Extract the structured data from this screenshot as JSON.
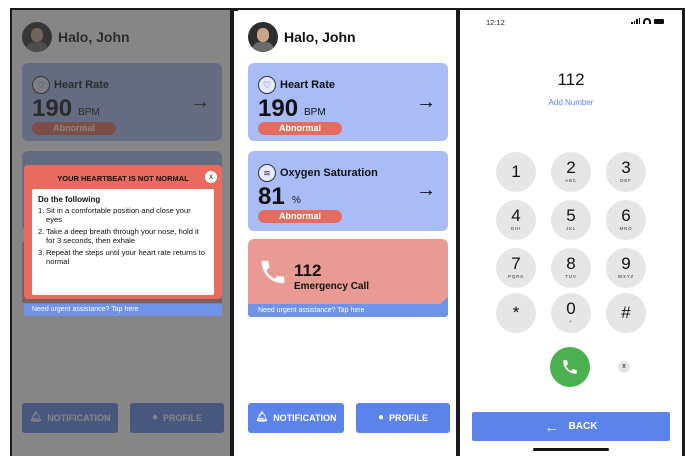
{
  "greeting": {
    "text": "Halo, John"
  },
  "heart_rate": {
    "title": "Heart Rate",
    "value": "190",
    "unit": "BPM",
    "status": "Abnormal"
  },
  "oxygen": {
    "title": "Oxygen Saturation",
    "value": "81",
    "unit": "%",
    "status": "Abnormal"
  },
  "emergency": {
    "number": "112",
    "label": "Emergency Call",
    "strip": "Need urgent assistance? Tap here"
  },
  "nav": {
    "notification": "NOTIFICATION",
    "profile": "PROFILE"
  },
  "modal": {
    "title": "YOUR HEARTBEAT IS NOT NORMAL",
    "close": "x",
    "lead": "Do the following",
    "steps": [
      {
        "n": "1.",
        "text": "Sit in a comfortable position and close your eyes"
      },
      {
        "n": "2.",
        "text": "Take a deep breath through your nose, hold it for 3 seconds, then exhale"
      },
      {
        "n": "3.",
        "text": "Repeat the steps until your heart rate returns to normal"
      }
    ],
    "footer": "Need urgent assistance? Tap here"
  },
  "dialer": {
    "time": "12:12",
    "number": "112",
    "add_number": "Add Number",
    "keys": [
      {
        "digit": "1",
        "letters": ""
      },
      {
        "digit": "2",
        "letters": "ABC"
      },
      {
        "digit": "3",
        "letters": "DEF"
      },
      {
        "digit": "4",
        "letters": "GHI"
      },
      {
        "digit": "5",
        "letters": "JKL"
      },
      {
        "digit": "6",
        "letters": "MNO"
      },
      {
        "digit": "7",
        "letters": "PQRS"
      },
      {
        "digit": "8",
        "letters": "TUV"
      },
      {
        "digit": "9",
        "letters": "WXYZ"
      },
      {
        "digit": "*",
        "letters": ""
      },
      {
        "digit": "0",
        "letters": "+"
      },
      {
        "digit": "#",
        "letters": ""
      }
    ],
    "delete": "x",
    "back": "BACK"
  },
  "colors": {
    "card_blue": "#a9bcf5",
    "accent_blue": "#5b83ea",
    "alert_red": "#e46c61",
    "emergency_pink": "#e99a94",
    "call_green": "#4caf50"
  }
}
